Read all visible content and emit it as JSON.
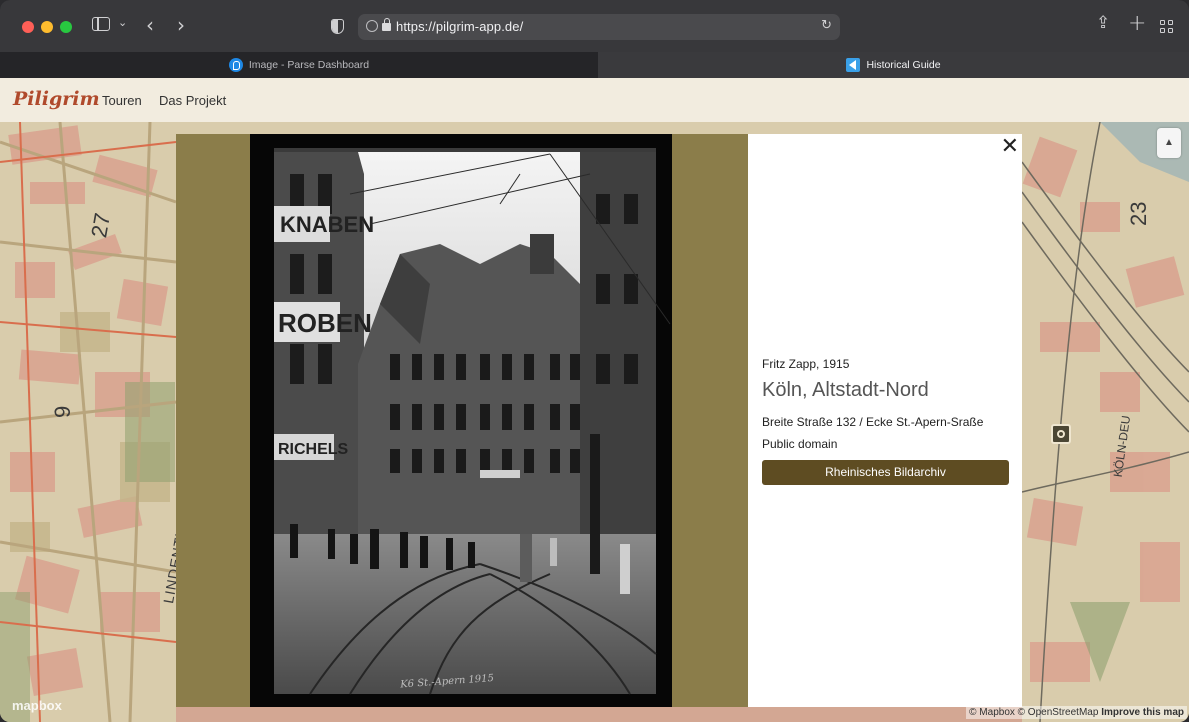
{
  "browser": {
    "url": "https://pilgrim-app.de/",
    "tabs": [
      {
        "label": "Image - Parse Dashboard",
        "active": false
      },
      {
        "label": "Historical Guide",
        "active": true
      }
    ]
  },
  "app": {
    "logo": "Piligrim",
    "nav": [
      "Touren",
      "Das Projekt"
    ]
  },
  "map": {
    "labels": [
      "27",
      "9",
      "23",
      "LINDENTHAL",
      "KÖLN-DEU"
    ],
    "logo": "mapbox",
    "attribution": {
      "text": "© Mapbox © OpenStreetMap ",
      "improve": "Improve this map"
    }
  },
  "photo": {
    "author_year": "Fritz Zapp, 1915",
    "place": "Köln, Altstadt-Nord",
    "street": "Breite Straße 132 / Ecke St.-Apern-Sraße",
    "license": "Public domain",
    "archive_button": "Rheinisches Bildarchiv",
    "sign_texts": [
      "KNABEN",
      "ROBEN",
      "RICHELS"
    ]
  },
  "colors": {
    "modal_bg": "#8b7d4a",
    "button_bg": "#5e4c22",
    "logo": "#b04a2c",
    "header_bg": "#f2ecdf"
  }
}
